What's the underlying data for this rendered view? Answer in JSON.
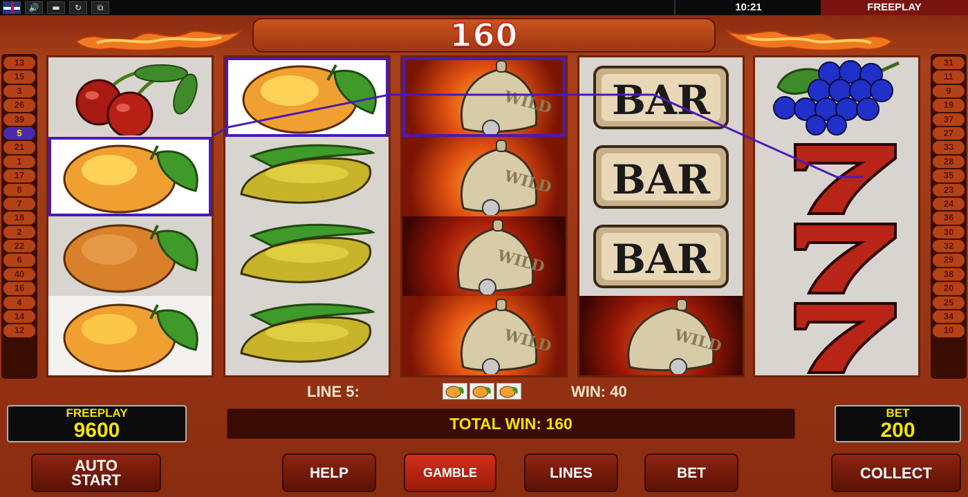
{
  "topbar": {
    "time": "10:21",
    "mode": "FREEPLAY",
    "icons": [
      "flag-uk-icon",
      "speaker-icon",
      "fullscreen-icon",
      "refresh-icon",
      "window-icon"
    ]
  },
  "banner": {
    "win_amount": "160"
  },
  "left_lines": [
    "13",
    "15",
    "3",
    "26",
    "39",
    "5",
    "21",
    "1",
    "17",
    "8",
    "7",
    "18",
    "2",
    "22",
    "6",
    "40",
    "16",
    "4",
    "14",
    "12"
  ],
  "right_lines": [
    "31",
    "11",
    "9",
    "19",
    "37",
    "27",
    "33",
    "28",
    "35",
    "23",
    "24",
    "36",
    "30",
    "32",
    "29",
    "38",
    "20",
    "25",
    "34",
    "10"
  ],
  "active_line": "5",
  "reels": [
    [
      "cherry",
      "orange",
      "orange",
      "orange"
    ],
    [
      "orange",
      "lemon",
      "lemon",
      "lemon"
    ],
    [
      "wild-bell",
      "wild-bell",
      "wild-bell",
      "wild-bell"
    ],
    [
      "bar",
      "bar",
      "bar",
      "wild-bell"
    ],
    [
      "grapes",
      "seven",
      "seven",
      "seven"
    ]
  ],
  "info": {
    "line_label": "LINE 5:",
    "win_label": "WIN: 40",
    "symbols": [
      "orange",
      "orange",
      "orange"
    ]
  },
  "credit": {
    "label": "FREEPLAY",
    "value": "9600"
  },
  "total_win": "TOTAL WIN: 160",
  "bet": {
    "label": "BET",
    "value": "200"
  },
  "buttons": {
    "auto_start_1": "AUTO",
    "auto_start_2": "START",
    "help": "HELP",
    "gamble": "GAMBLE",
    "lines": "LINES",
    "bet": "BET",
    "collect": "COLLECT"
  },
  "symbol_text": {
    "bar": "BAR",
    "wild": "WILD"
  },
  "colors": {
    "frame": "#8a2c10",
    "highlight": "#4a1ab8",
    "value_yellow": "#f2e400"
  }
}
